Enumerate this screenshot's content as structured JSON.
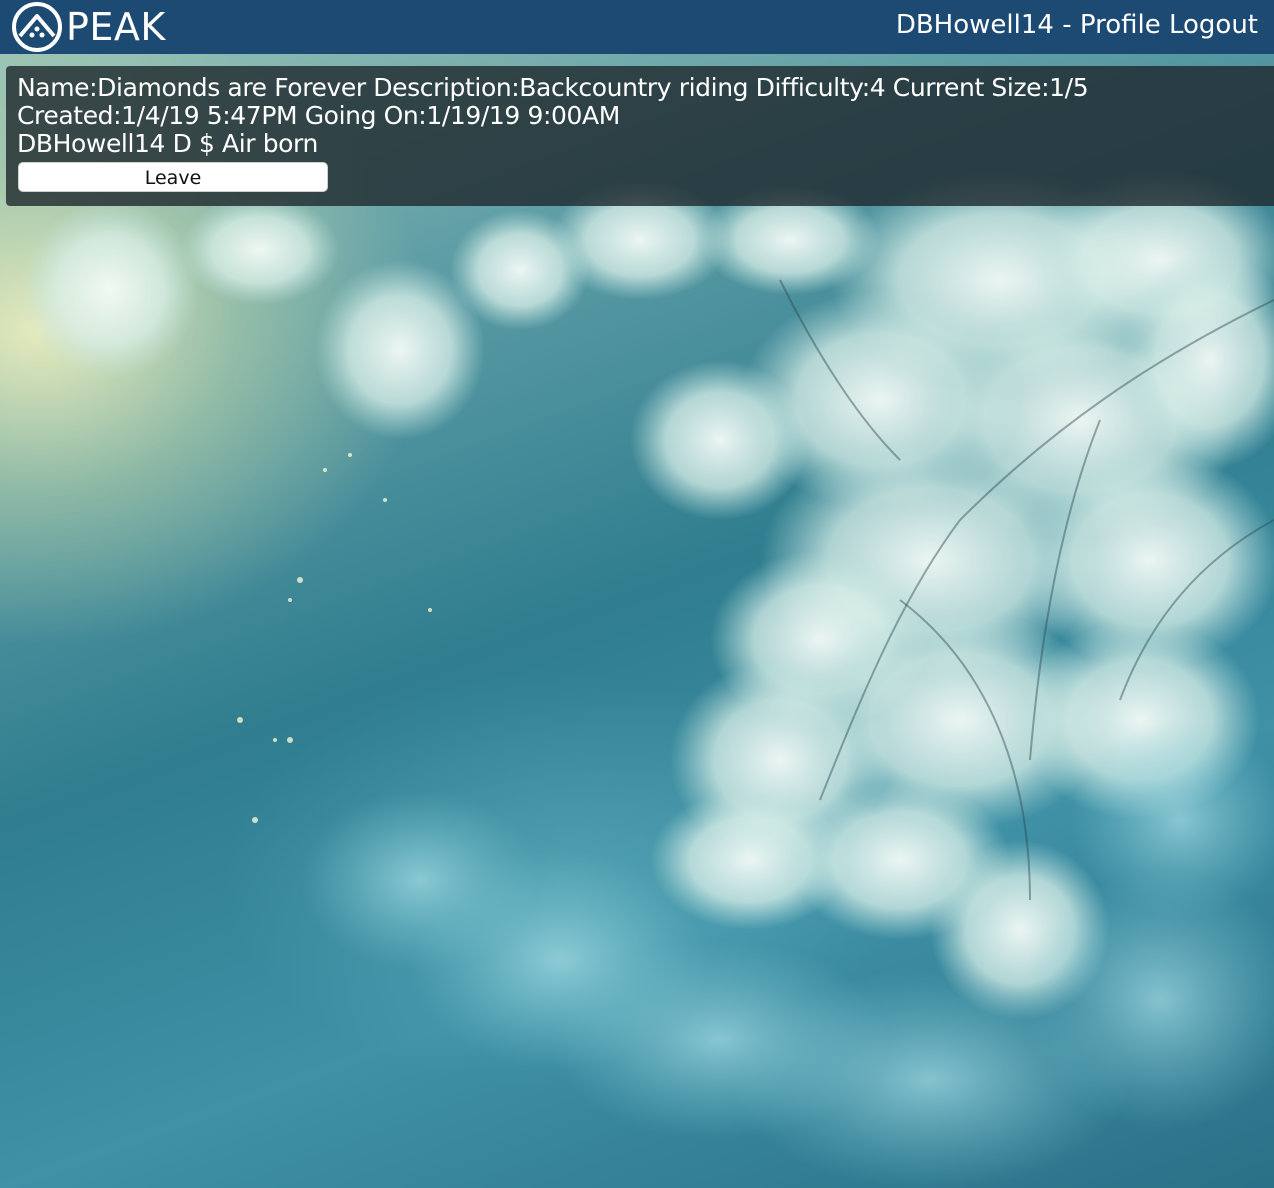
{
  "brand": {
    "name": "PEAK",
    "logo_icon": "mountain-circle-icon"
  },
  "nav": {
    "username": "DBHowell14",
    "separator": "-",
    "profile_label": "Profile",
    "logout_label": "Logout"
  },
  "group": {
    "line1": "Name:Diamonds are Forever Description:Backcountry riding Difficulty:4 Current Size:1/5",
    "line2": "Created:1/4/19 5:47PM Going On:1/19/19 9:00AM",
    "line3": "DBHowell14 D $ Air born",
    "leave_label": "Leave"
  },
  "colors": {
    "header_bg": "#1c4a73",
    "card_bg": "rgba(30,40,45,0.80)",
    "text": "#ffffff"
  },
  "background": {
    "description_icon": "frosted-pine-background"
  }
}
